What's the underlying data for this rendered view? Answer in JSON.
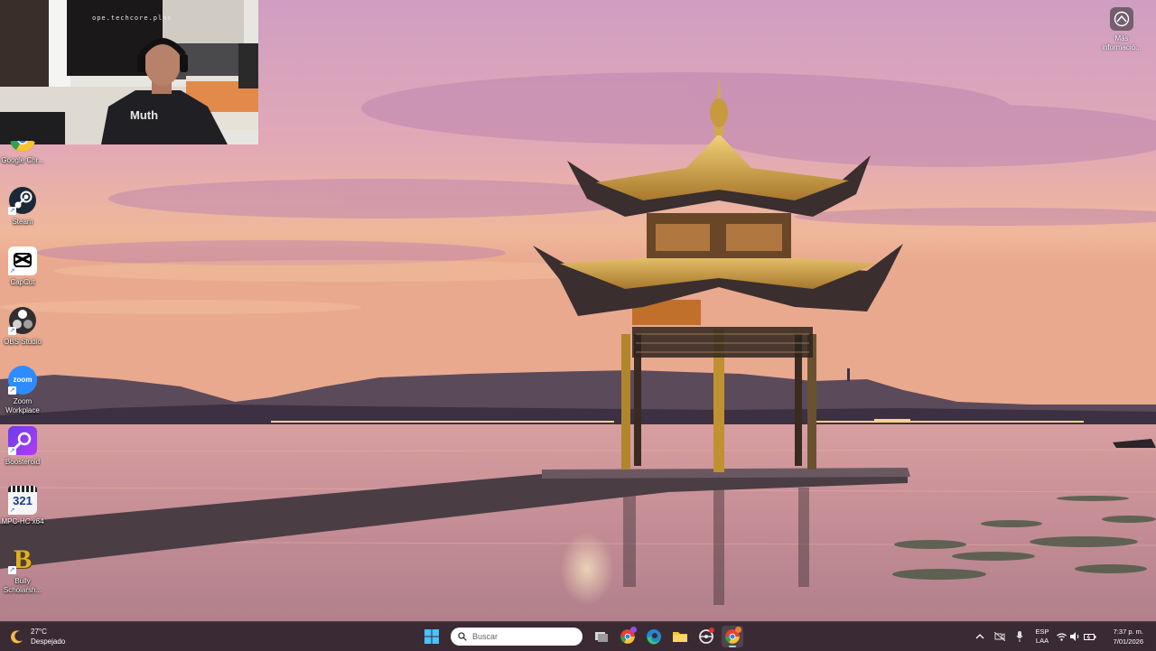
{
  "webcam": {
    "stamp": "ope.techcore.plan"
  },
  "desktop_icons": [
    {
      "name": "desktop-icon-google-chrome",
      "label": "Google Chr...",
      "icon": "chrome-icon"
    },
    {
      "name": "desktop-icon-steam",
      "label": "Steam",
      "icon": "steam-icon"
    },
    {
      "name": "desktop-icon-capcut",
      "label": "CapCut",
      "icon": "capcut-icon"
    },
    {
      "name": "desktop-icon-obs",
      "label": "OBS Studio",
      "icon": "obs-icon"
    },
    {
      "name": "desktop-icon-zoom",
      "label": "Zoom Workplace",
      "icon": "zoom-icon",
      "badge": "zoom"
    },
    {
      "name": "desktop-icon-boosteroid",
      "label": "Boosteroid",
      "icon": "boosteroid-icon"
    },
    {
      "name": "desktop-icon-mpc",
      "label": "MPC-HC x64",
      "icon": "mpc-icon",
      "badge": "321"
    },
    {
      "name": "desktop-icon-bully",
      "label": "Bully Scholarsh...",
      "icon": "bully-icon",
      "badge": "B"
    }
  ],
  "spotlight": {
    "label": "Más informació..."
  },
  "taskbar": {
    "weather": {
      "temp": "27°C",
      "desc": "Despejado"
    },
    "search_placeholder": "Buscar",
    "lang": {
      "line1": "ESP",
      "line2": "LAA"
    },
    "clock": {
      "time": "7:37 p. m.",
      "date": "7/01/2026"
    }
  },
  "colors": {
    "taskbar": "#3a2a33",
    "chrome_red": "#e34133",
    "zoom_blue": "#2d8cff"
  }
}
